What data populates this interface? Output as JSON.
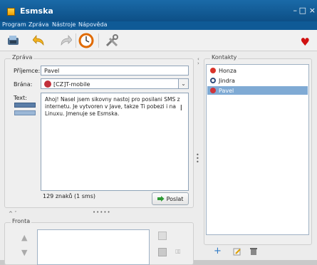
{
  "window": {
    "title": "Esmska",
    "minimize_label": "–",
    "maximize_label": "□",
    "close_label": "×"
  },
  "menu": [
    "Program",
    "Zpráva",
    "Nástroje",
    "Nápověda"
  ],
  "toolbar": {
    "icons": [
      "send-icon",
      "undo-icon",
      "redo-icon",
      "history-icon",
      "settings-icon"
    ],
    "heart_label": "♥"
  },
  "message": {
    "group_title": "Zpráva",
    "recipient_label": "Příjemce:",
    "recipient_value": "Pavel",
    "gateway_label": "Brána:",
    "gateway_value": "[CZ]T-mobile",
    "text_label": "Text:",
    "text_value": "Ahoj! Nasel jsem sikovny nastoj pro posilani SMS z internetu. Je vytvoren v Jave, takze Ti pobezi i na Linuxu. Jmenuje se Esmska.",
    "counter": "129 znaků (1 sms)",
    "send_label": "Poslat"
  },
  "contacts": {
    "group_title": "Kontakty",
    "items": [
      {
        "name": "Honza",
        "color": "#d9342b",
        "selected": false
      },
      {
        "name": "Jindra",
        "color": "#2f4b7a",
        "selected": false
      },
      {
        "name": "Pavel",
        "color": "#d0343a",
        "selected": true
      }
    ]
  },
  "queue": {
    "group_title": "Fronta"
  },
  "colors": {
    "titlebar": "#0d4f86",
    "selection": "#7faad4",
    "accent": "#d01111"
  }
}
